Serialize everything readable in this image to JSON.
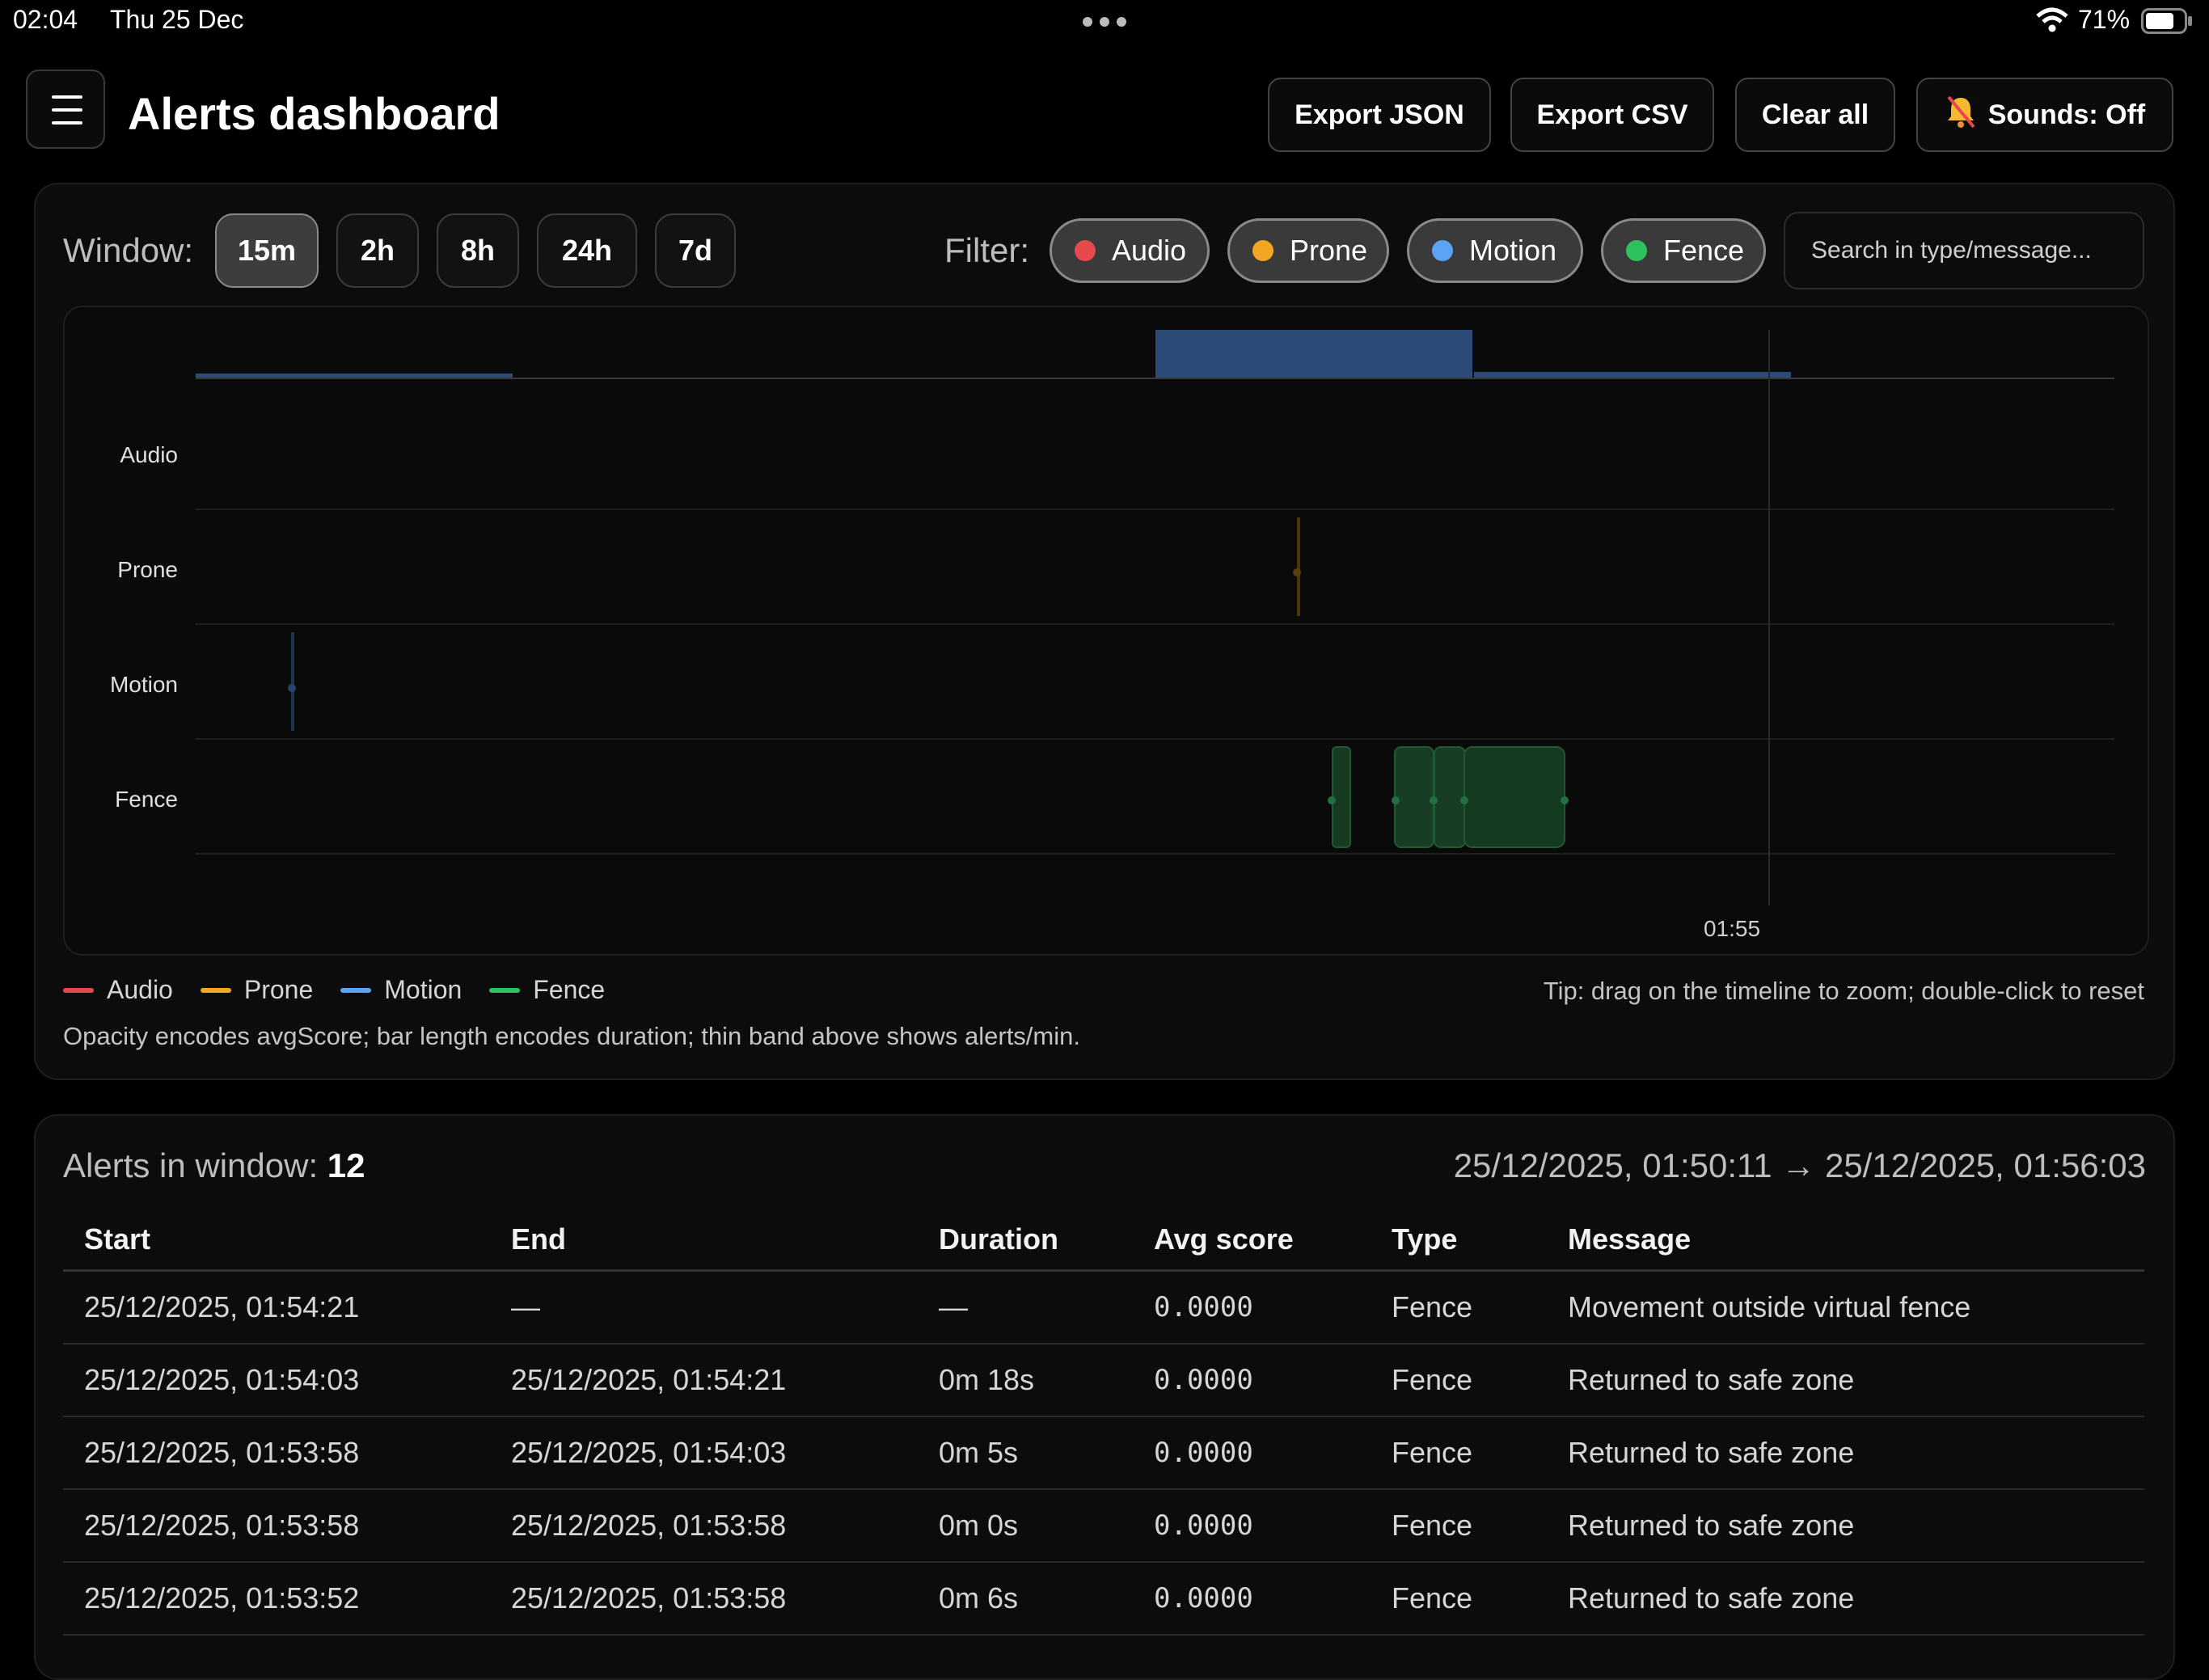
{
  "status_bar": {
    "time": "02:04",
    "date": "Thu 25 Dec",
    "battery": "71%"
  },
  "header": {
    "title": "Alerts dashboard",
    "buttons": {
      "export_json": "Export JSON",
      "export_csv": "Export CSV",
      "clear_all": "Clear all",
      "sounds": "Sounds: Off"
    },
    "sounds_icon": "bell-slash-icon"
  },
  "controls": {
    "window_label": "Window:",
    "windows": [
      "15m",
      "2h",
      "8h",
      "24h",
      "7d"
    ],
    "active_window": "15m",
    "filter_label": "Filter:",
    "filters": [
      "Audio",
      "Prone",
      "Motion",
      "Fence"
    ],
    "search_placeholder": "Search in type/message..."
  },
  "colors": {
    "Audio": "#e5484d",
    "Prone": "#f5a524",
    "Motion": "#5ba4f5",
    "Fence": "#2ec25d",
    "band": "#2b4a75"
  },
  "chart": {
    "rows": [
      "Audio",
      "Prone",
      "Motion",
      "Fence"
    ],
    "time_tick": "01:55",
    "legend": [
      "Audio",
      "Prone",
      "Motion",
      "Fence"
    ],
    "tip": "Tip: drag on the timeline to zoom; double-click to reset",
    "note": "Opacity encodes avgScore; bar length encodes duration; thin band above shows alerts/min."
  },
  "chart_data": {
    "type": "timeline",
    "rows": [
      "Audio",
      "Prone",
      "Motion",
      "Fence"
    ],
    "x_tick": "01:55",
    "events": [
      {
        "type": "Motion",
        "start": "01:50:14",
        "end": "01:50:14"
      },
      {
        "type": "Prone",
        "start": "01:53:08",
        "end": "01:53:08"
      },
      {
        "type": "Fence",
        "start": "01:53:17",
        "end": "01:53:20"
      },
      {
        "type": "Fence",
        "start": "01:53:29",
        "end": "01:53:36"
      },
      {
        "type": "Fence",
        "start": "01:53:36",
        "end": "01:53:42"
      },
      {
        "type": "Fence",
        "start": "01:53:52",
        "end": "01:53:58"
      },
      {
        "type": "Fence",
        "start": "01:53:58",
        "end": "01:53:58"
      },
      {
        "type": "Fence",
        "start": "01:53:58",
        "end": "01:54:03"
      },
      {
        "type": "Fence",
        "start": "01:54:03",
        "end": "01:54:21"
      }
    ],
    "rate_band": [
      {
        "minute": "01:50",
        "alerts_per_min": 1
      },
      {
        "minute": "01:51",
        "alerts_per_min": 0
      },
      {
        "minute": "01:52",
        "alerts_per_min": 0
      },
      {
        "minute": "01:53",
        "alerts_per_min": 9
      },
      {
        "minute": "01:54",
        "alerts_per_min": 1
      },
      {
        "minute": "01:55",
        "alerts_per_min": 0
      }
    ]
  },
  "summary": {
    "label": "Alerts in window:",
    "count": "12",
    "range": "25/12/2025, 01:50:11 → 25/12/2025, 01:56:03"
  },
  "table": {
    "headers": [
      "Start",
      "End",
      "Duration",
      "Avg score",
      "Type",
      "Message"
    ],
    "rows": [
      [
        "25/12/2025, 01:54:21",
        "—",
        "—",
        "0.0000",
        "Fence",
        "Movement outside virtual fence"
      ],
      [
        "25/12/2025, 01:54:03",
        "25/12/2025, 01:54:21",
        "0m 18s",
        "0.0000",
        "Fence",
        "Returned to safe zone"
      ],
      [
        "25/12/2025, 01:53:58",
        "25/12/2025, 01:54:03",
        "0m 5s",
        "0.0000",
        "Fence",
        "Returned to safe zone"
      ],
      [
        "25/12/2025, 01:53:58",
        "25/12/2025, 01:53:58",
        "0m 0s",
        "0.0000",
        "Fence",
        "Returned to safe zone"
      ],
      [
        "25/12/2025, 01:53:52",
        "25/12/2025, 01:53:58",
        "0m 6s",
        "0.0000",
        "Fence",
        "Returned to safe zone"
      ]
    ]
  }
}
